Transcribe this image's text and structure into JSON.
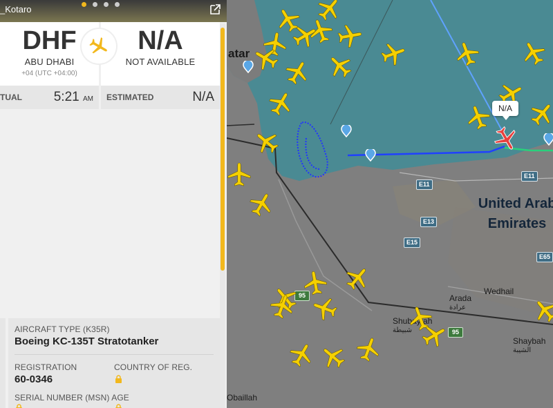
{
  "panel": {
    "user_label": "_Kotaro",
    "origin": {
      "code": "DHF",
      "city": "ABU DHABI",
      "timezone": "+04 (UTC +04:00)"
    },
    "destination": {
      "code": "N/A",
      "city": "NOT AVAILABLE"
    },
    "actual": {
      "label": "TUAL",
      "time": "5:21",
      "ampm": "AM"
    },
    "estimated": {
      "label": "ESTIMATED",
      "time": "N/A"
    },
    "aircraft": {
      "type_label": "AIRCRAFT TYPE",
      "type_code": "(K35R)",
      "type_name": "Boeing KC-135T Stratotanker",
      "registration_label": "REGISTRATION",
      "registration": "60-0346",
      "country_label": "COUNTRY OF REG.",
      "serial_label": "SERIAL NUMBER (MSN)",
      "age_label": "AGE"
    },
    "accent_color": "#f2b81d"
  },
  "map": {
    "labels": {
      "qatar": "atar",
      "uae_line1": "United Arab",
      "uae_line2": "Emirates",
      "arada": "Arada",
      "arada_ar": "عرادة",
      "wedhail": "Wedhail",
      "shubaytah": "Shubaytah",
      "shubaytah_ar": "شبيطة",
      "shaybah": "Shaybah",
      "shaybah_ar": "الشيبة",
      "obaillah": "Obaillah"
    },
    "roads": {
      "e11a": "E11",
      "e11b": "E11",
      "e13": "E13",
      "e15": "E15",
      "e65": "E65",
      "r95a": "95",
      "r95b": "95"
    },
    "callout": "N/A",
    "colors": {
      "water": "#4a8a93",
      "land": "#7f7f7f",
      "track": "#1a3cff",
      "selected_plane": "#e8413e",
      "plane": "#f5d000"
    }
  }
}
